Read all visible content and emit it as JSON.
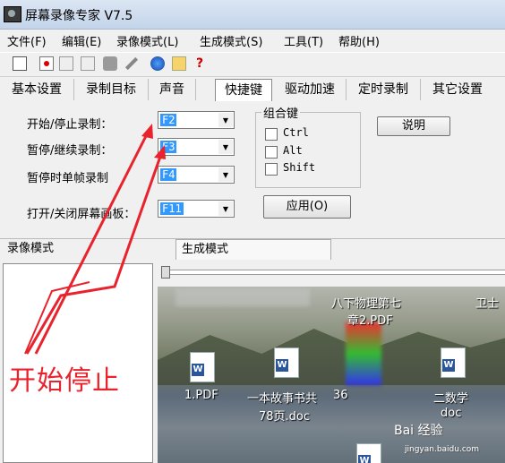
{
  "window": {
    "title": "屏幕录像专家 V7.5"
  },
  "menu": [
    "文件(F)",
    "编辑(E)",
    "录像模式(L)",
    "生成模式(S)",
    "工具(T)",
    "帮助(H)"
  ],
  "tabs": [
    {
      "label": "基本设置"
    },
    {
      "label": "录制目标"
    },
    {
      "label": "声音"
    },
    {
      "label": "快捷键"
    },
    {
      "label": "驱动加速"
    },
    {
      "label": "定时录制"
    },
    {
      "label": "其它设置"
    }
  ],
  "hotkeys": [
    {
      "label": "开始/停止录制：",
      "value": "F2"
    },
    {
      "label": "暂停/继续录制：",
      "value": "F3"
    },
    {
      "label": "暂停时单帧录制",
      "value": "F4"
    },
    {
      "label": "打开/关闭屏幕画板：",
      "value": "F11"
    }
  ],
  "modifier_group": {
    "title": "组合键",
    "options": [
      "Ctrl",
      "Alt",
      "Shift"
    ]
  },
  "buttons": {
    "explain": "说明",
    "apply": "应用(O)"
  },
  "bottom_tabs": {
    "record_mode": "录像模式",
    "generate_mode": "生成模式"
  },
  "desktop_files": [
    {
      "label": "八下物理第七"
    },
    {
      "label": "章2.PDF"
    },
    {
      "label": "卫士"
    },
    {
      "label": "1.PDF"
    },
    {
      "label": "一本故事书共"
    },
    {
      "label": "36"
    },
    {
      "label": "78页.doc"
    },
    {
      "label": "二数学"
    },
    {
      "label": "doc"
    }
  ],
  "annotation": "开始停止",
  "watermark": {
    "brand": "Bai 经验",
    "url": "jingyan.baidu.com"
  },
  "colors": {
    "annotation": "#e8232d",
    "selection": "#3399ff"
  }
}
